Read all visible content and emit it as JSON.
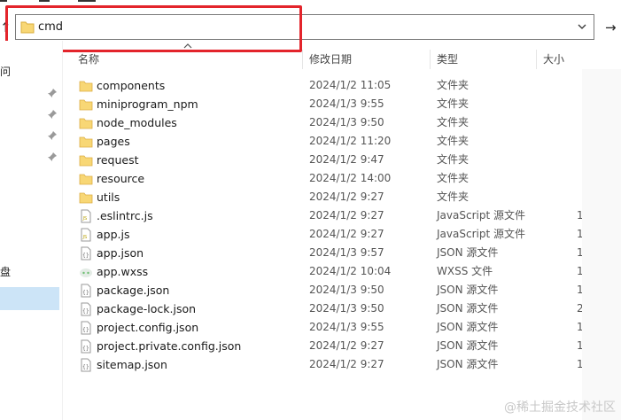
{
  "address_bar": {
    "path": "cmd",
    "folder_icon": "folder-icon",
    "dropdown_icon": "chevron-down-icon"
  },
  "navigation": {
    "up_icon": "arrow-up-icon",
    "up_glyph": "↑",
    "go_icon": "arrow-right-icon",
    "go_glyph": "→"
  },
  "sidebar": {
    "edge_labels": [
      "问",
      "盘"
    ],
    "pin_icon": "pin-icon"
  },
  "columns": {
    "name": "名称",
    "modified": "修改日期",
    "type": "类型",
    "size": "大小"
  },
  "files": [
    {
      "name": "components",
      "modified": "2024/1/2 11:05",
      "type": "文件夹",
      "size": "",
      "icon": "folder-icon"
    },
    {
      "name": "miniprogram_npm",
      "modified": "2024/1/3 9:55",
      "type": "文件夹",
      "size": "",
      "icon": "folder-icon"
    },
    {
      "name": "node_modules",
      "modified": "2024/1/3 9:50",
      "type": "文件夹",
      "size": "",
      "icon": "folder-icon"
    },
    {
      "name": "pages",
      "modified": "2024/1/2 11:20",
      "type": "文件夹",
      "size": "",
      "icon": "folder-icon"
    },
    {
      "name": "request",
      "modified": "2024/1/2 9:47",
      "type": "文件夹",
      "size": "",
      "icon": "folder-icon"
    },
    {
      "name": "resource",
      "modified": "2024/1/2 14:00",
      "type": "文件夹",
      "size": "",
      "icon": "folder-icon"
    },
    {
      "name": "utils",
      "modified": "2024/1/2 9:27",
      "type": "文件夹",
      "size": "",
      "icon": "folder-icon"
    },
    {
      "name": ".eslintrc.js",
      "modified": "2024/1/2 9:27",
      "type": "JavaScript 源文件",
      "size": "1",
      "icon": "js-file-icon"
    },
    {
      "name": "app.js",
      "modified": "2024/1/2 9:27",
      "type": "JavaScript 源文件",
      "size": "1",
      "icon": "js-file-icon"
    },
    {
      "name": "app.json",
      "modified": "2024/1/3 9:57",
      "type": "JSON 源文件",
      "size": "1",
      "icon": "json-file-icon"
    },
    {
      "name": "app.wxss",
      "modified": "2024/1/2 10:04",
      "type": "WXSS 文件",
      "size": "1",
      "icon": "wxss-file-icon"
    },
    {
      "name": "package.json",
      "modified": "2024/1/3 9:50",
      "type": "JSON 源文件",
      "size": "1",
      "icon": "json-file-icon"
    },
    {
      "name": "package-lock.json",
      "modified": "2024/1/3 9:50",
      "type": "JSON 源文件",
      "size": "2",
      "icon": "json-file-icon"
    },
    {
      "name": "project.config.json",
      "modified": "2024/1/3 9:55",
      "type": "JSON 源文件",
      "size": "1",
      "icon": "json-file-icon"
    },
    {
      "name": "project.private.config.json",
      "modified": "2024/1/2 9:27",
      "type": "JSON 源文件",
      "size": "1",
      "icon": "json-file-icon"
    },
    {
      "name": "sitemap.json",
      "modified": "2024/1/2 9:27",
      "type": "JSON 源文件",
      "size": "1",
      "icon": "json-file-icon"
    }
  ],
  "watermark": "@稀土掘金技术社区",
  "colors": {
    "highlight": "#e3242b",
    "folder": "#f8d775",
    "selection": "#cce4f7"
  }
}
